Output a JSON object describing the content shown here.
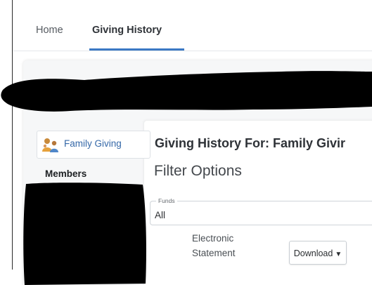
{
  "tabs": [
    {
      "label": "Home",
      "active": false
    },
    {
      "label": "Giving History",
      "active": true
    }
  ],
  "accent_color": "#3b78c4",
  "sidebar": {
    "family": {
      "label": "Family Giving",
      "icon": "family-people-icon"
    },
    "members_heading": "Members"
  },
  "main": {
    "title": "Giving History For: Family Givir",
    "filter_heading": "Filter Options",
    "funds": {
      "legend": "Funds",
      "value": "All"
    },
    "statement": {
      "label_line1": "Electronic",
      "label_line2": "Statement",
      "download_label": "Download",
      "download_icon": "caret-down-icon"
    }
  }
}
